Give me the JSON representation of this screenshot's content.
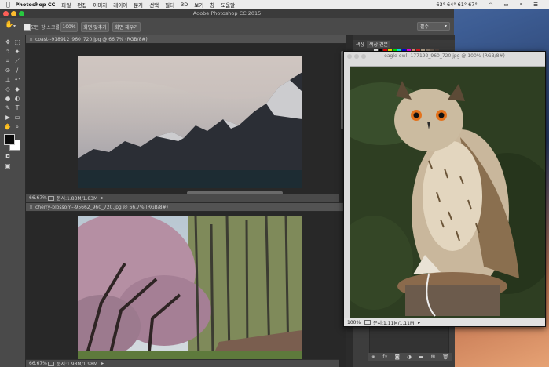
{
  "menubar": {
    "apple_icon": "apple-icon",
    "items": [
      "Photoshop CC",
      "파일",
      "편집",
      "이미지",
      "레이어",
      "문자",
      "선택",
      "필터",
      "3D",
      "보기",
      "창",
      "도움말"
    ],
    "status": "63° 64° 61° 67°"
  },
  "window": {
    "title": "Adobe Photoshop CC 2015"
  },
  "options": {
    "all_layers_label": "모든 창 스크롤",
    "zoom_100": "100%",
    "fit_screen": "화면 맞추기",
    "fill_screen": "화면 채우기",
    "workspace": "필수"
  },
  "docs": {
    "coast": {
      "tab": "coast--918912_960_720.jpg @ 66.7% (RGB/8#)",
      "zoom": "66.67%",
      "info": "문서:1.83M/1.83M"
    },
    "cherry": {
      "tab": "cherry-blossom--95662_960_720.jpg @ 66.7% (RGB/8#)",
      "zoom": "66.67%",
      "info": "문서:1.98M/1.98M"
    },
    "owl": {
      "tab": "eagle-owl--177192_960_720.jpg @ 100% (RGB/8#)",
      "zoom": "100%",
      "info": "문서:1.11M/1.11M"
    }
  },
  "panels": {
    "tab1": "색상",
    "tab2": "색상 견본"
  },
  "colors": {
    "foreground": "#0a0a0a",
    "background": "#ffffff"
  },
  "icons": [
    "move-icon",
    "marquee-icon",
    "lasso-icon",
    "magic-wand-icon",
    "crop-icon",
    "eyedropper-icon",
    "heal-icon",
    "brush-icon",
    "stamp-icon",
    "history-brush-icon",
    "eraser-icon",
    "fill-icon",
    "blur-icon",
    "dodge-icon",
    "pen-icon",
    "type-icon",
    "path-select-icon",
    "shape-icon",
    "hand-icon",
    "zoom-icon"
  ]
}
